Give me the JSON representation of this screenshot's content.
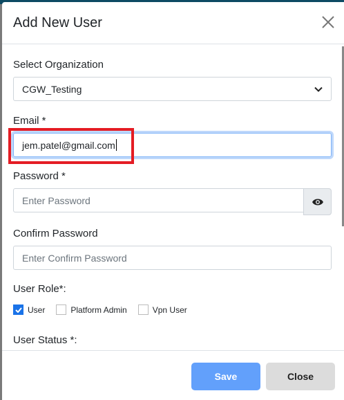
{
  "modal": {
    "title": "Add New User"
  },
  "org": {
    "label": "Select Organization",
    "value": "CGW_Testing"
  },
  "email": {
    "label": "Email *",
    "value": "jem.patel@gmail.com"
  },
  "password": {
    "label": "Password *",
    "placeholder": "Enter Password"
  },
  "confirm": {
    "label": "Confirm Password",
    "placeholder": "Enter Confirm Password"
  },
  "role": {
    "label": "User Role*:",
    "options": [
      {
        "label": "User",
        "checked": true
      },
      {
        "label": "Platform Admin",
        "checked": false
      },
      {
        "label": "Vpn User",
        "checked": false
      }
    ]
  },
  "status": {
    "label": "User Status *:"
  },
  "footer": {
    "save": "Save",
    "close": "Close"
  },
  "colors": {
    "accent": "#62a0fb",
    "highlight": "#e41c24"
  }
}
